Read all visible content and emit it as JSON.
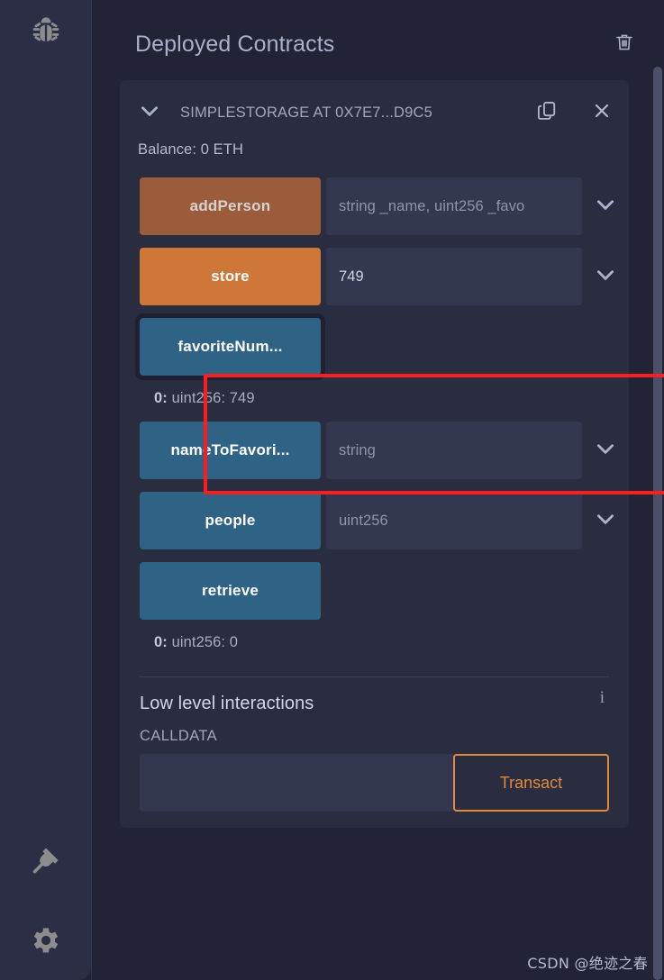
{
  "colors": {
    "page_bg": "#222436",
    "rail_bg": "#2b2e44",
    "card_bg": "#2a2c40",
    "input_bg": "#343750",
    "payable_button": "#9b5c3c",
    "transact_button": "#cf7639",
    "call_button": "#2f6385",
    "accent_orange": "#e08b3c",
    "highlight_red": "#fa1e23",
    "scrollbar_thumb": "#4b4f67"
  },
  "sidebar": {
    "items": [
      {
        "name": "debugger",
        "icon": "bug-icon"
      },
      {
        "name": "plugin-manager",
        "icon": "plug-icon"
      },
      {
        "name": "settings",
        "icon": "gear-icon"
      }
    ]
  },
  "header": {
    "title": "Deployed Contracts",
    "delete_icon": "trash-icon"
  },
  "contract": {
    "expand_icon": "chevron-down-icon",
    "name": "SIMPLESTORAGE AT 0X7E7...D9C5",
    "copy_icon": "copy-icon",
    "close_icon": "close-icon",
    "balance": "Balance: 0 ETH"
  },
  "functions": [
    {
      "label": "addPerson",
      "kind": "payable",
      "has_input": true,
      "input_value": "",
      "placeholder": "string _name, uint256 _favo",
      "has_chevron": true,
      "focused": false,
      "result": null
    },
    {
      "label": "store",
      "kind": "transact",
      "has_input": true,
      "input_value": "749",
      "placeholder": "",
      "has_chevron": true,
      "focused": false,
      "result": null
    },
    {
      "label": "favoriteNum...",
      "kind": "call",
      "has_input": false,
      "input_value": "",
      "placeholder": "",
      "has_chevron": false,
      "focused": true,
      "result": {
        "index": "0:",
        "value": "uint256: 749"
      }
    },
    {
      "label": "nameToFavori...",
      "kind": "call",
      "has_input": true,
      "input_value": "",
      "placeholder": "string",
      "has_chevron": true,
      "focused": false,
      "result": null
    },
    {
      "label": "people",
      "kind": "call",
      "has_input": true,
      "input_value": "",
      "placeholder": "uint256",
      "has_chevron": true,
      "focused": false,
      "result": null
    },
    {
      "label": "retrieve",
      "kind": "call",
      "has_input": false,
      "input_value": "",
      "placeholder": "",
      "has_chevron": false,
      "focused": false,
      "result": {
        "index": "0:",
        "value": "uint256: 0"
      }
    }
  ],
  "low_level": {
    "title": "Low level interactions",
    "info_icon": "info-icon",
    "info_glyph": "i",
    "calldata_label": "CALLDATA",
    "calldata_value": "",
    "calldata_placeholder": "",
    "transact_label": "Transact"
  },
  "watermark": "CSDN @绝迹之春"
}
